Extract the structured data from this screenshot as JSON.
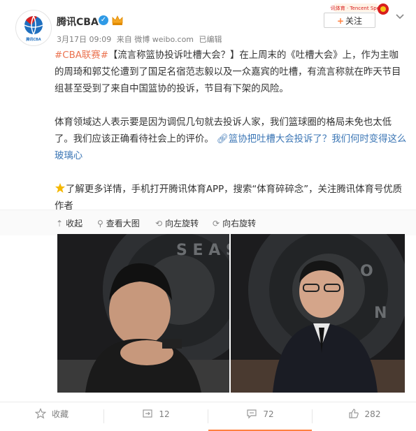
{
  "post": {
    "username": "腾讯CBA",
    "verified_glyph": "✓",
    "avatar_icon": "basketball-logo-icon",
    "avatar_text": "腾讯CBA",
    "date": "3月17日 09:09",
    "source": "来自 微博 weibo.com",
    "edited": "已编辑",
    "follow_plus": "+",
    "follow_label": "关注",
    "banner_text": "腾讯体育 · Tencent Sports"
  },
  "content": {
    "hashtag": "#CBA联赛#",
    "title_link": "【流言称篮协投诉吐槽大会？】",
    "para1_rest": "在上周末的《吐槽大会》上，作为主咖的周琦和郭艾伦遭到了国足名宿范志毅以及一众嘉宾的吐槽，有流言称就在昨天节目组甚至受到了来自中国篮协的投诉，节目有下架的风险。",
    "para2": "体育领域达人表示要是因为调侃几句就去投诉人家，我们篮球圈的格局未免也太低了。我们应该正确看待社会上的评价。",
    "para2_link_icon": "link-icon",
    "para2_link": "篮协把吐槽大会投诉了？我们何时变得这么玻璃心",
    "para3": "了解更多详情，手机打开腾讯体育APP，搜索“体育碎碎念”，关注腾讯体育号优质作者",
    "star_icon": "star-icon"
  },
  "media_tools": {
    "collapse": "收起",
    "view_large": "查看大图",
    "rotate_left": "向左旋转",
    "rotate_right": "向右旋转"
  },
  "media": {
    "left_photo": "周琦 吐槽大会 现场照片",
    "right_photo": "郭艾伦 吐槽大会 现场照片"
  },
  "footer": {
    "favorite": "收藏",
    "repost_count": "12",
    "comment_count": "72",
    "like_count": "282"
  },
  "colors": {
    "link": "#eb7350",
    "accent_orange": "#ff8140",
    "verify_blue": "#2f9ae6",
    "brand_red": "#d81e1e",
    "brand_blue": "#1e6fbf"
  }
}
